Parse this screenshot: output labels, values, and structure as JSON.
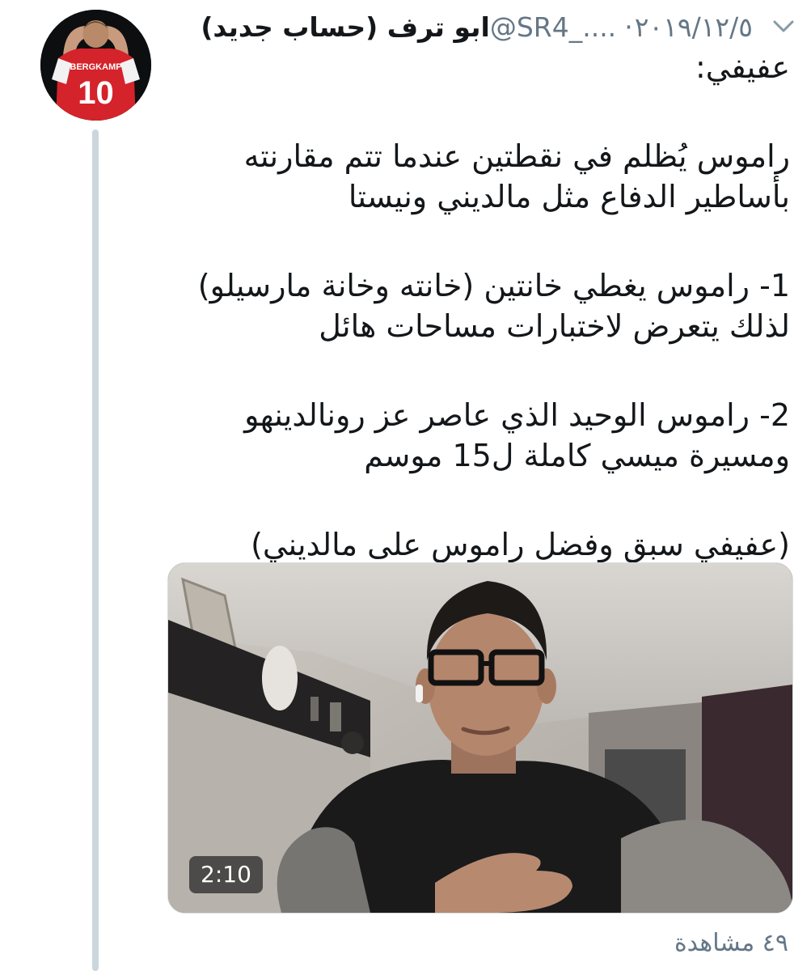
{
  "author": {
    "display_name": "ابو ترف (حساب جديد)",
    "handle": "@SR4_....",
    "separator": "·",
    "date": "٢٠١٩/١٢/٥",
    "avatar_jersey_name": "BERGKAMP",
    "avatar_jersey_number": "10"
  },
  "tweet": {
    "paragraphs": [
      [
        "عفيفي:"
      ],
      [
        "راموس يُظلم في نقطتين عندما تتم مقارنته",
        "بأساطير الدفاع مثل مالديني ونيستا"
      ],
      [
        "1- راموس يغطي خانتين (خانته وخانة مارسيلو)",
        "لذلك يتعرض لاختبارات مساحات هائل"
      ],
      [
        "2- راموس الوحيد الذي عاصر عز رونالدينهو",
        "ومسيرة ميسي كاملة ل15 موسم"
      ],
      [
        "(عفيفي سبق وفضل راموس على مالديني)"
      ]
    ]
  },
  "video": {
    "duration": "2:10"
  },
  "stats": {
    "views": "٤٩ مشاهدة"
  },
  "colors": {
    "text": "#14171a",
    "muted": "#657786",
    "thread_line": "#ccd6dd",
    "jersey_red": "#d4232a"
  }
}
